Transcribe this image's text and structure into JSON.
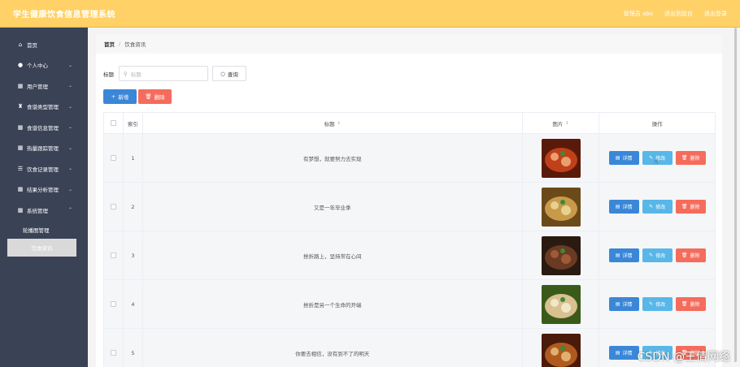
{
  "header": {
    "title": "学生健康饮食信息管理系统",
    "user_label": "管理员 abo",
    "exit_admin": "退出到前台",
    "logout": "退出登录"
  },
  "sidebar": {
    "items": [
      {
        "label": "首页",
        "icon": "home-icon",
        "has_children": false
      },
      {
        "label": "个人中心",
        "icon": "user-icon",
        "has_children": true
      },
      {
        "label": "用户管理",
        "icon": "grid-icon",
        "has_children": true
      },
      {
        "label": "食谱类型管理",
        "icon": "trophy-icon",
        "has_children": true
      },
      {
        "label": "食谱信息管理",
        "icon": "grid-icon",
        "has_children": true
      },
      {
        "label": "热量跟踪管理",
        "icon": "grid-icon",
        "has_children": true
      },
      {
        "label": "饮食记录管理",
        "icon": "sliders-icon",
        "has_children": true
      },
      {
        "label": "结果分析管理",
        "icon": "grid-icon",
        "has_children": true
      },
      {
        "label": "系统管理",
        "icon": "grid-icon",
        "has_children": true
      }
    ],
    "sub_items": [
      {
        "label": "轮播图管理",
        "active": false
      },
      {
        "label": "饮食资讯",
        "active": true
      }
    ]
  },
  "breadcrumb": {
    "home": "首页",
    "current": "饮食资讯"
  },
  "search": {
    "label": "标题",
    "placeholder": "标题",
    "query_button": "查询"
  },
  "actions": {
    "add": "新增",
    "delete": "删除"
  },
  "table": {
    "headers": {
      "index": "索引",
      "title": "标题",
      "picture": "图片",
      "operation": "操作"
    },
    "op_labels": {
      "detail": "详情",
      "edit": "修改",
      "delete": "删除"
    },
    "rows": [
      {
        "index": "1",
        "title": "有梦想，就要努力去实现"
      },
      {
        "index": "2",
        "title": "又是一年毕业季"
      },
      {
        "index": "3",
        "title": "挫折路上，坚持常在心间"
      },
      {
        "index": "4",
        "title": "挫折是另一个生命的开端"
      },
      {
        "index": "5",
        "title": "你要去相信，没有到不了的明天"
      }
    ]
  },
  "watermark": "CSDN @王倩网络",
  "colors": {
    "header": "#ffd166",
    "sidebar": "#3a4256",
    "primary": "#3a87d8",
    "info": "#58b7e8",
    "danger": "#f56c5c"
  }
}
